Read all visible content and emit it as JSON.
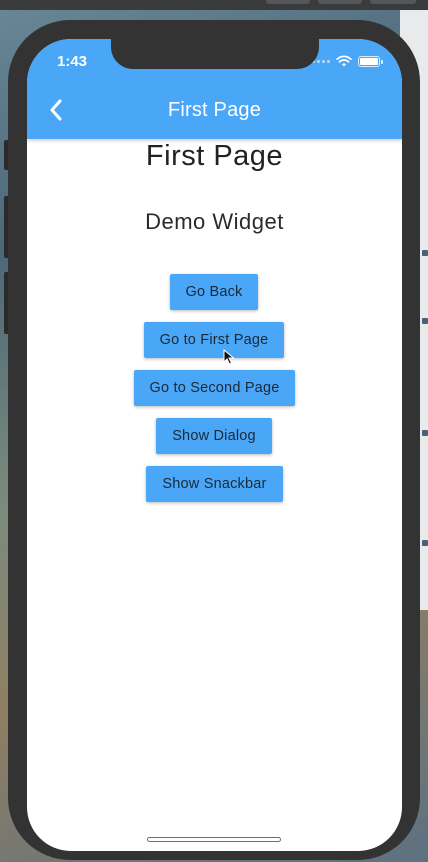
{
  "status_bar": {
    "time": "1:43"
  },
  "app_bar": {
    "title": "First Page",
    "back_icon": "chevron-left-icon",
    "color": "#4aa6f7"
  },
  "content": {
    "heading": "First Page",
    "subheading": "Demo Widget"
  },
  "buttons": [
    {
      "label": "Go Back"
    },
    {
      "label": "Go to First Page"
    },
    {
      "label": "Go to Second Page"
    },
    {
      "label": "Show Dialog"
    },
    {
      "label": "Show Snackbar"
    }
  ],
  "colors": {
    "accent": "#4aa6f7",
    "device_frame": "#333333"
  }
}
